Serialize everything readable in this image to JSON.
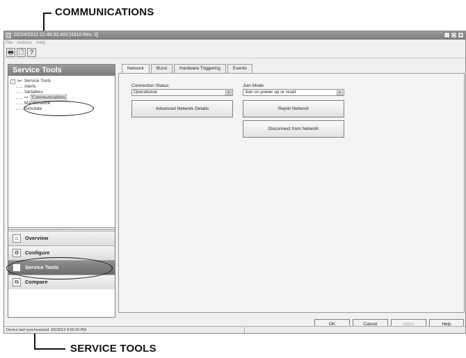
{
  "callouts": {
    "top": "COMMUNICATIONS",
    "bottom": "SERVICE TOOLS"
  },
  "window": {
    "title": "02/24/2012 21:49:32.483 [4310 Rev. 3]",
    "minimize": "_",
    "maximize": "□",
    "close": "×"
  },
  "menu": {
    "file": "File",
    "actions": "Actions",
    "help": "Help"
  },
  "toolbar": {
    "print_icon": "🖶",
    "preview_icon": "🗋",
    "help_icon": "?"
  },
  "left_pane": {
    "header": "Service Tools",
    "tree": {
      "root": "Service Tools",
      "expander": "−",
      "items": [
        "Alerts",
        "Variables",
        "Communications",
        "Maintenance",
        "Simulate"
      ]
    },
    "nav": {
      "overview": "Overview",
      "configure": "Configure",
      "service_tools": "Service Tools",
      "compare": "Compare"
    }
  },
  "tabs": [
    "Network",
    "Burst",
    "Hardware Triggering",
    "Events"
  ],
  "network": {
    "connection_status_label": "Connection Status:",
    "connection_status_value": "Operational",
    "join_mode_label": "Join Mode",
    "join_mode_value": "Join on power up or reset",
    "advanced_btn": "Advanced Network Details",
    "rejoin_btn": "Rejoin Network",
    "disconnect_btn": "Disconnect from Network"
  },
  "dialog_buttons": {
    "ok": "OK",
    "cancel": "Cancel",
    "apply": "Apply",
    "help": "Help"
  },
  "status": {
    "text": "Device last synchronized: 3/5/2012 4:56:20 PM"
  }
}
